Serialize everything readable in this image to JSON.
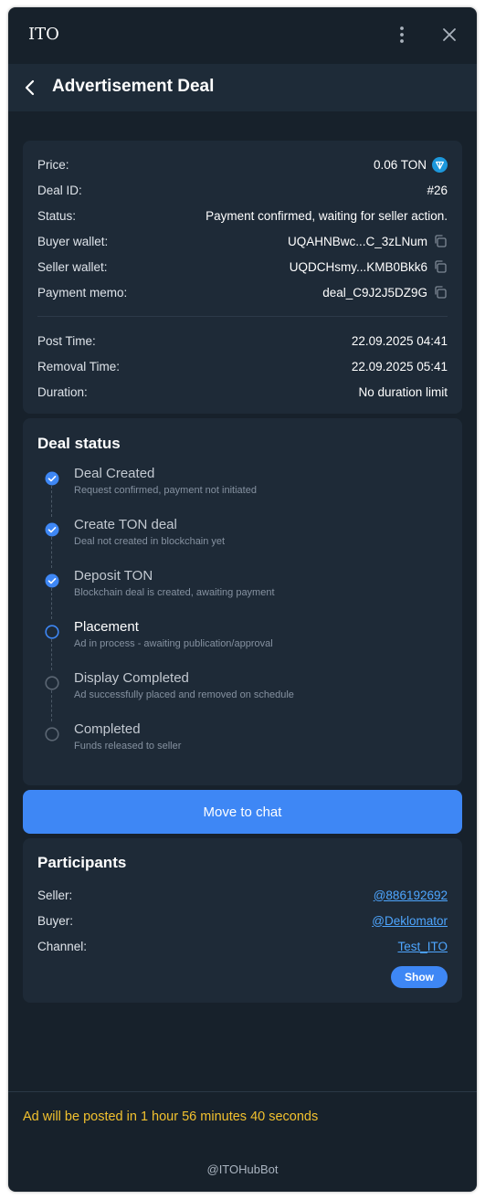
{
  "app": {
    "title": "ITO"
  },
  "header": {
    "title": "Advertisement Deal"
  },
  "details": {
    "price_label": "Price:",
    "price_value": "0.06 TON",
    "deal_id_label": "Deal ID:",
    "deal_id_value": "#26",
    "status_label": "Status:",
    "status_value": "Payment confirmed, waiting for seller action.",
    "buyer_wallet_label": "Buyer wallet:",
    "buyer_wallet_value": "UQAHNBwc...C_3zLNum",
    "seller_wallet_label": "Seller wallet:",
    "seller_wallet_value": "UQDCHsmy...KMB0Bkk6",
    "memo_label": "Payment memo:",
    "memo_value": "deal_C9J2J5DZ9G",
    "post_time_label": "Post Time:",
    "post_time_value": "22.09.2025 04:41",
    "removal_time_label": "Removal Time:",
    "removal_time_value": "22.09.2025 05:41",
    "duration_label": "Duration:",
    "duration_value": "No duration limit"
  },
  "deal_status": {
    "title": "Deal status",
    "steps": [
      {
        "title": "Deal Created",
        "subtitle": "Request confirmed, payment not initiated",
        "state": "done"
      },
      {
        "title": "Create TON deal",
        "subtitle": "Deal not created in blockchain yet",
        "state": "done"
      },
      {
        "title": "Deposit TON",
        "subtitle": "Blockchain deal is created, awaiting payment",
        "state": "done"
      },
      {
        "title": "Placement",
        "subtitle": "Ad in process - awaiting publication/approval",
        "state": "current"
      },
      {
        "title": "Display Completed",
        "subtitle": "Ad successfully placed and removed on schedule",
        "state": "pending"
      },
      {
        "title": "Completed",
        "subtitle": "Funds released to seller",
        "state": "pending"
      }
    ]
  },
  "chat_button": {
    "label": "Move to chat"
  },
  "participants": {
    "title": "Participants",
    "seller_label": "Seller:",
    "seller_value": "@886192692",
    "buyer_label": "Buyer:",
    "buyer_value": "@Deklomator",
    "channel_label": "Channel:",
    "channel_value": "Test_ITO",
    "show_label": "Show"
  },
  "countdown": "Ad will be posted in 1 hour 56 minutes 40 seconds",
  "footer": {
    "bot": "@ITOHubBot"
  },
  "colors": {
    "background": "#17212b",
    "card": "#1e2a37",
    "accent": "#3e87f5",
    "link": "#4ea6ff",
    "warning": "#f2c12e",
    "ton": "#1d98dc"
  }
}
